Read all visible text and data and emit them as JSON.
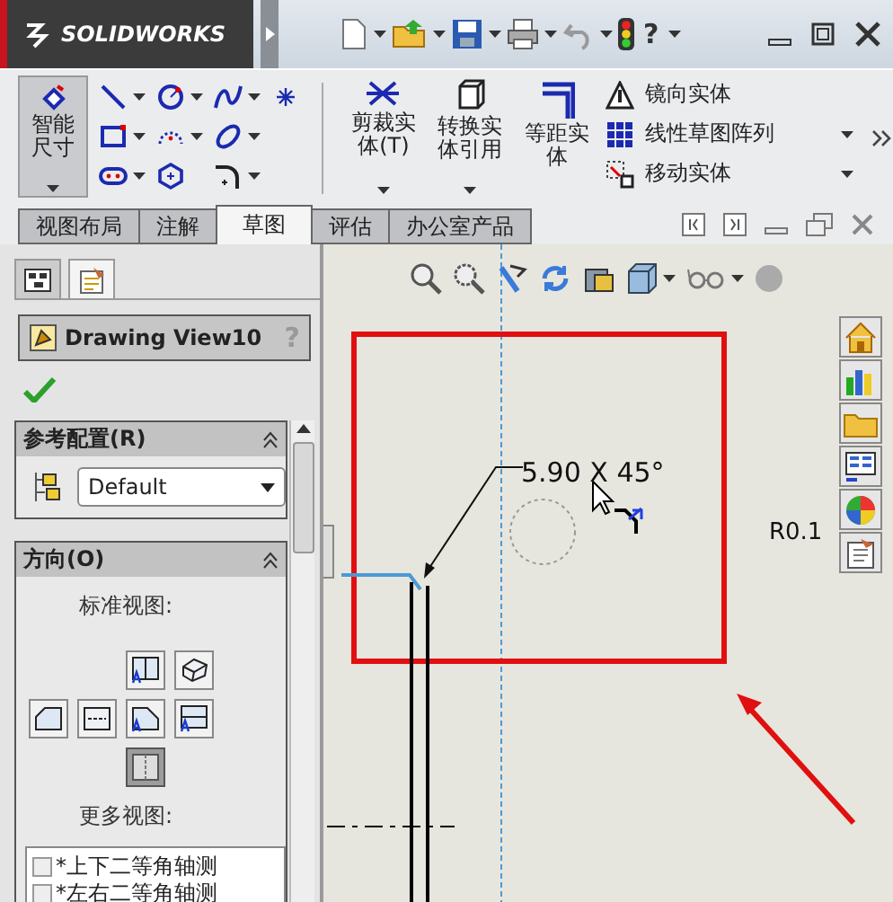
{
  "title_bar": {
    "logo": "SOLIDWORKS",
    "help": "?"
  },
  "ribbon": {
    "smart_dimension": {
      "label": "智能尺寸",
      "selected": true
    },
    "tools": [
      {
        "label": "剪裁实体(T)",
        "menu": true
      },
      {
        "label": "转换实体引用",
        "menu": true
      },
      {
        "label": "等距实体",
        "menu": false
      }
    ],
    "commands": [
      {
        "label": "镜向实体",
        "menu": false
      },
      {
        "label": "线性草图阵列",
        "menu": true
      },
      {
        "label": "移动实体",
        "menu": true
      }
    ]
  },
  "tabs": [
    {
      "label": "视图布局",
      "selected": false
    },
    {
      "label": "注解",
      "selected": false
    },
    {
      "label": "草图",
      "selected": true
    },
    {
      "label": "评估",
      "selected": false
    },
    {
      "label": "办公室产品",
      "selected": false
    }
  ],
  "property_manager": {
    "tabs": [
      {
        "kind": "tree",
        "selected": false
      },
      {
        "kind": "properties",
        "selected": true
      }
    ],
    "title": "Drawing View10",
    "help": "?",
    "reference_configuration": {
      "heading": "参考配置(R)",
      "value": "Default"
    },
    "orientation": {
      "heading": "方向(O)",
      "standard_views_label": "标准视图:",
      "view_buttons": [
        {
          "kind": "split-a",
          "selected": false
        },
        {
          "kind": "solid",
          "selected": false
        },
        {
          "kind": "plate",
          "selected": false
        },
        {
          "kind": "dash",
          "selected": false
        },
        {
          "kind": "chamfer-a",
          "selected": false
        },
        {
          "kind": "top-a",
          "selected": false
        },
        {
          "kind": "split",
          "selected": true
        }
      ],
      "more_views_label": "更多视图:",
      "more_views": [
        {
          "label": "*上下二等角轴测",
          "checked": false
        },
        {
          "label": "*左右二等角轴测",
          "checked": false
        }
      ]
    }
  },
  "drawing": {
    "dimension": "5.90 X 45°",
    "radius_label": "R0.1"
  }
}
